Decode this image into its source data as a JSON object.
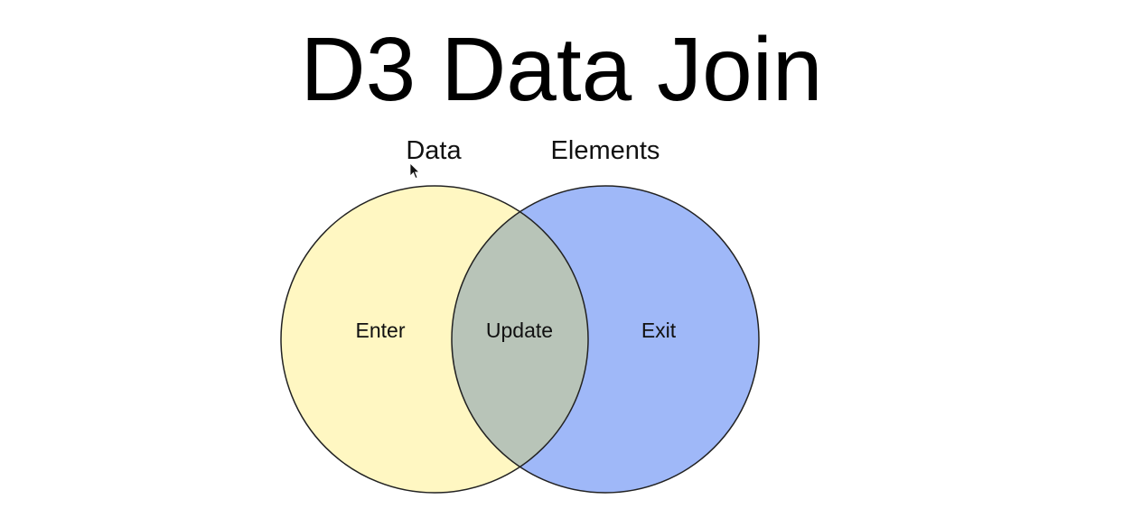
{
  "title": "D3 Data Join",
  "diagram": {
    "set_labels": {
      "left": "Data",
      "right": "Elements"
    },
    "regions": {
      "left_only": "Enter",
      "intersection": "Update",
      "right_only": "Exit"
    },
    "colors": {
      "left_fill": "#fff7c2",
      "right_fill": "#9fb8f8",
      "intersection_fill": "#b8c4b8",
      "outline": "#222222"
    }
  },
  "icons": {
    "cursor": "mouse-pointer-icon"
  }
}
